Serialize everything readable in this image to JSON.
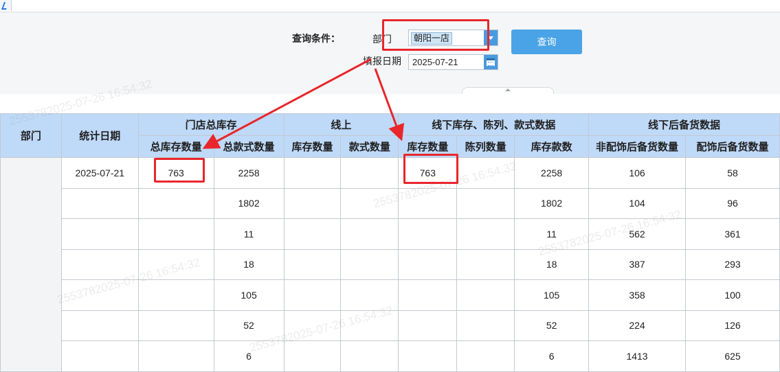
{
  "query": {
    "title": "查询条件：",
    "dept_label": "部门",
    "dept_value": "朝阳一店",
    "date_label": "填报日期",
    "date_value": "2025-07-21",
    "query_button": "查询"
  },
  "table": {
    "header": {
      "dept": "部门",
      "stat_date": "统计日期",
      "group_store_total": "门店总库存",
      "group_online": "线上",
      "group_offline": "线下库存、陈列、款式数据",
      "group_backup": "线下后备货数据",
      "total_stock_qty": "总库存数量",
      "total_style_qty": "总款式数量",
      "online_stock_qty": "库存数量",
      "online_style_qty": "款式数量",
      "offline_stock_qty": "库存数量",
      "display_qty": "陈列数量",
      "stock_style_count": "库存款数",
      "non_accessory_backup": "非配饰后备货数量",
      "accessory_backup": "配饰后备货数量"
    },
    "rows": [
      {
        "date": "2025-07-21",
        "total_stock": "763",
        "total_style": "2258",
        "online_stock": "",
        "online_style": "",
        "offline_stock": "763",
        "display": "",
        "stock_style": "2258",
        "non_acc": "106",
        "acc": "58"
      },
      {
        "date": "",
        "total_stock": "",
        "total_style": "1802",
        "online_stock": "",
        "online_style": "",
        "offline_stock": "",
        "display": "",
        "stock_style": "1802",
        "non_acc": "104",
        "acc": "96"
      },
      {
        "date": "",
        "total_stock": "",
        "total_style": "11",
        "online_stock": "",
        "online_style": "",
        "offline_stock": "",
        "display": "",
        "stock_style": "11",
        "non_acc": "562",
        "acc": "361"
      },
      {
        "date": "",
        "total_stock": "",
        "total_style": "18",
        "online_stock": "",
        "online_style": "",
        "offline_stock": "",
        "display": "",
        "stock_style": "18",
        "non_acc": "387",
        "acc": "293"
      },
      {
        "date": "",
        "total_stock": "",
        "total_style": "105",
        "online_stock": "",
        "online_style": "",
        "offline_stock": "",
        "display": "",
        "stock_style": "105",
        "non_acc": "358",
        "acc": "100"
      },
      {
        "date": "",
        "total_stock": "",
        "total_style": "52",
        "online_stock": "",
        "online_style": "",
        "offline_stock": "",
        "display": "",
        "stock_style": "52",
        "non_acc": "224",
        "acc": "126"
      },
      {
        "date": "",
        "total_stock": "",
        "total_style": "6",
        "online_stock": "",
        "online_style": "",
        "offline_stock": "",
        "display": "",
        "stock_style": "6",
        "non_acc": "1413",
        "acc": "625"
      }
    ]
  },
  "watermark_text": "2553782025-07-26 16:54:32",
  "colors": {
    "header_bg": "#bfd9f8",
    "accent_blue": "#4aa3e6",
    "annotation_red": "#e8262b"
  },
  "icons": {
    "dropdown": "chevron-down-icon",
    "calendar": "calendar-icon"
  }
}
